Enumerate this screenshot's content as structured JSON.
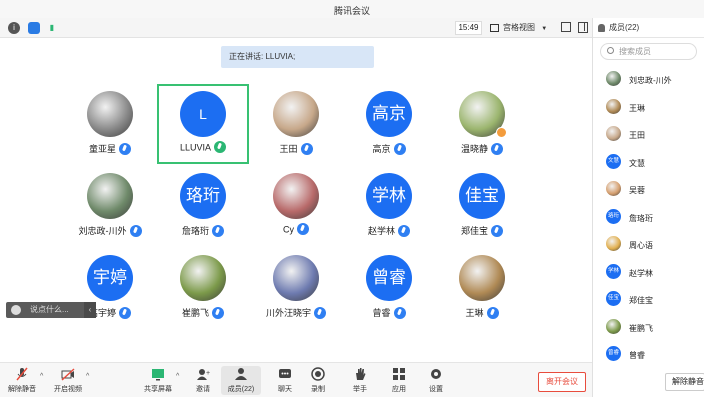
{
  "window": {
    "title": "腾讯会议"
  },
  "toolbar": {
    "clock": "15:49",
    "view_label": "宫格视图"
  },
  "speaking": "正在讲话: LLUVIA;",
  "participants_grid": [
    {
      "name": "童亚星",
      "avatar_text": "",
      "color": "#8a8a8a"
    },
    {
      "name": "LLUVIA",
      "avatar_text": "L",
      "color": "#1c6ef2"
    },
    {
      "name": "王田",
      "avatar_text": "",
      "color": "#c7a88a"
    },
    {
      "name": "高京",
      "avatar_text": "高京",
      "color": "#1c6ef2"
    },
    {
      "name": "温晓静",
      "avatar_text": "",
      "color": "#9bb56e"
    },
    {
      "name": "刘忠政-川外",
      "avatar_text": "",
      "color": "#6f8a6a"
    },
    {
      "name": "詹珞珩",
      "avatar_text": "珞珩",
      "color": "#1c6ef2"
    },
    {
      "name": "Cy",
      "avatar_text": "",
      "color": "#b86a6a"
    },
    {
      "name": "赵学林",
      "avatar_text": "学林",
      "color": "#1c6ef2"
    },
    {
      "name": "郑佳宝",
      "avatar_text": "佳宝",
      "color": "#1c6ef2"
    },
    {
      "name": "高宇婷",
      "avatar_text": "宇婷",
      "color": "#1c6ef2"
    },
    {
      "name": "崔鹏飞",
      "avatar_text": "",
      "color": "#7c9a4a"
    },
    {
      "name": "川外汪晓宇",
      "avatar_text": "",
      "color": "#6e7bb0"
    },
    {
      "name": "曾睿",
      "avatar_text": "曾睿",
      "color": "#1c6ef2"
    },
    {
      "name": "王琳",
      "avatar_text": "",
      "color": "#b08a55"
    }
  ],
  "chat": {
    "placeholder": "说点什么..."
  },
  "bottom": {
    "unmute": "解除静音",
    "video": "开启视频",
    "share": "共享屏幕",
    "invite": "邀请",
    "members": "成员(22)",
    "chat": "聊天",
    "record": "录制",
    "hand": "举手",
    "apps": "应用",
    "settings": "设置",
    "leave": "离开会议"
  },
  "panel": {
    "title": "成员(22)",
    "search_placeholder": "搜索成员",
    "members": [
      {
        "name": "刘忠政-川外",
        "avatar_text": "",
        "color": "#6f8a6a"
      },
      {
        "name": "王琳",
        "avatar_text": "",
        "color": "#b08a55"
      },
      {
        "name": "王田",
        "avatar_text": "",
        "color": "#c7a88a"
      },
      {
        "name": "文慧",
        "avatar_text": "文慧",
        "color": "#1c6ef2"
      },
      {
        "name": "吴蓉",
        "avatar_text": "",
        "color": "#d6a070"
      },
      {
        "name": "詹珞珩",
        "avatar_text": "珞珩",
        "color": "#1c6ef2"
      },
      {
        "name": "周心语",
        "avatar_text": "",
        "color": "#e2b050"
      },
      {
        "name": "赵学林",
        "avatar_text": "学林",
        "color": "#1c6ef2"
      },
      {
        "name": "郑佳宝",
        "avatar_text": "佳宝",
        "color": "#1c6ef2"
      },
      {
        "name": "崔鹏飞",
        "avatar_text": "",
        "color": "#7c9a4a"
      },
      {
        "name": "曾睿",
        "avatar_text": "曾睿",
        "color": "#1c6ef2"
      }
    ],
    "mute_all": "解除静音"
  }
}
